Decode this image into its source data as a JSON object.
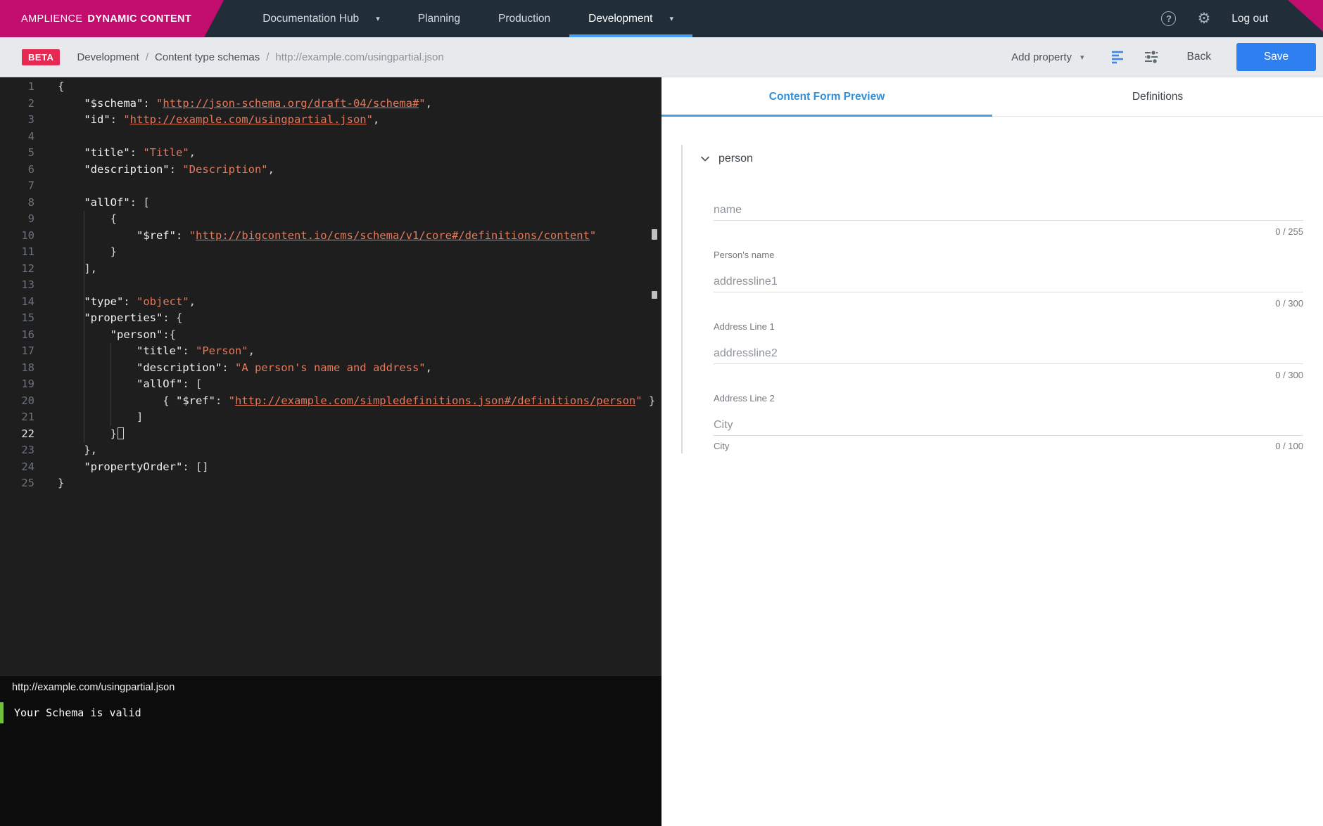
{
  "colors": {
    "brand_pink": "#c10d6e",
    "topnav_bg": "#212e3a",
    "active_tab_blue": "#45a0e6",
    "save_blue": "#2e7ff0",
    "beta_red": "#e42a52",
    "valid_green": "#72c13c",
    "editor_bg": "#1e1e1e",
    "string_orange": "#e5795b"
  },
  "topnav": {
    "brand": {
      "name_light": "AMPLIENCE",
      "name_bold": "DYNAMIC CONTENT"
    },
    "items": [
      {
        "label": "Documentation Hub",
        "has_caret": true,
        "active": false
      },
      {
        "label": "Planning",
        "has_caret": false,
        "active": false
      },
      {
        "label": "Production",
        "has_caret": false,
        "active": false
      },
      {
        "label": "Development",
        "has_caret": true,
        "active": true
      }
    ],
    "help_icon": "?",
    "gear_icon": "gear",
    "logout_label": "Log out"
  },
  "toolbar": {
    "beta_label": "BETA",
    "breadcrumb": [
      "Development",
      "Content type schemas",
      "http://example.com/usingpartial.json"
    ],
    "add_property_label": "Add property",
    "back_label": "Back",
    "save_label": "Save"
  },
  "editor": {
    "filename": "http://example.com/usingpartial.json",
    "validation": "Your Schema is valid",
    "lines": [
      {
        "n": 1,
        "tokens": [
          {
            "t": "{",
            "c": "p"
          }
        ]
      },
      {
        "n": 2,
        "tokens": [
          {
            "t": "    ",
            "c": "p"
          },
          {
            "t": "\"$schema\"",
            "c": "k"
          },
          {
            "t": ": ",
            "c": "p"
          },
          {
            "t": "\"",
            "c": "s"
          },
          {
            "t": "http://json-schema.org/draft-04/schema#",
            "c": "u"
          },
          {
            "t": "\"",
            "c": "s"
          },
          {
            "t": ",",
            "c": "p"
          }
        ]
      },
      {
        "n": 3,
        "tokens": [
          {
            "t": "    ",
            "c": "p"
          },
          {
            "t": "\"id\"",
            "c": "k"
          },
          {
            "t": ": ",
            "c": "p"
          },
          {
            "t": "\"",
            "c": "s"
          },
          {
            "t": "http://example.com/usingpartial.json",
            "c": "u"
          },
          {
            "t": "\"",
            "c": "s"
          },
          {
            "t": ",",
            "c": "p"
          }
        ]
      },
      {
        "n": 4,
        "tokens": []
      },
      {
        "n": 5,
        "tokens": [
          {
            "t": "    ",
            "c": "p"
          },
          {
            "t": "\"title\"",
            "c": "k"
          },
          {
            "t": ": ",
            "c": "p"
          },
          {
            "t": "\"Title\"",
            "c": "s"
          },
          {
            "t": ",",
            "c": "p"
          }
        ]
      },
      {
        "n": 6,
        "tokens": [
          {
            "t": "    ",
            "c": "p"
          },
          {
            "t": "\"description\"",
            "c": "k"
          },
          {
            "t": ": ",
            "c": "p"
          },
          {
            "t": "\"Description\"",
            "c": "s"
          },
          {
            "t": ",",
            "c": "p"
          }
        ]
      },
      {
        "n": 7,
        "tokens": []
      },
      {
        "n": 8,
        "tokens": [
          {
            "t": "    ",
            "c": "p"
          },
          {
            "t": "\"allOf\"",
            "c": "k"
          },
          {
            "t": ": [",
            "c": "p"
          }
        ]
      },
      {
        "n": 9,
        "tokens": [
          {
            "t": "        {",
            "c": "p"
          }
        ]
      },
      {
        "n": 10,
        "tokens": [
          {
            "t": "            ",
            "c": "p"
          },
          {
            "t": "\"$ref\"",
            "c": "k"
          },
          {
            "t": ": ",
            "c": "p"
          },
          {
            "t": "\"",
            "c": "s"
          },
          {
            "t": "http://bigcontent.io/cms/schema/v1/core#/definitions/content",
            "c": "u"
          },
          {
            "t": "\"",
            "c": "s"
          }
        ]
      },
      {
        "n": 11,
        "tokens": [
          {
            "t": "        }",
            "c": "p"
          }
        ]
      },
      {
        "n": 12,
        "tokens": [
          {
            "t": "    ],",
            "c": "p"
          }
        ]
      },
      {
        "n": 13,
        "tokens": []
      },
      {
        "n": 14,
        "tokens": [
          {
            "t": "    ",
            "c": "p"
          },
          {
            "t": "\"type\"",
            "c": "k"
          },
          {
            "t": ": ",
            "c": "p"
          },
          {
            "t": "\"object\"",
            "c": "s"
          },
          {
            "t": ",",
            "c": "p"
          }
        ]
      },
      {
        "n": 15,
        "tokens": [
          {
            "t": "    ",
            "c": "p"
          },
          {
            "t": "\"properties\"",
            "c": "k"
          },
          {
            "t": ": {",
            "c": "p"
          }
        ]
      },
      {
        "n": 16,
        "tokens": [
          {
            "t": "        ",
            "c": "p"
          },
          {
            "t": "\"person\"",
            "c": "k"
          },
          {
            "t": ":{",
            "c": "p"
          }
        ]
      },
      {
        "n": 17,
        "tokens": [
          {
            "t": "            ",
            "c": "p"
          },
          {
            "t": "\"title\"",
            "c": "k"
          },
          {
            "t": ": ",
            "c": "p"
          },
          {
            "t": "\"Person\"",
            "c": "s"
          },
          {
            "t": ",",
            "c": "p"
          }
        ]
      },
      {
        "n": 18,
        "tokens": [
          {
            "t": "            ",
            "c": "p"
          },
          {
            "t": "\"description\"",
            "c": "k"
          },
          {
            "t": ": ",
            "c": "p"
          },
          {
            "t": "\"A person's name and address\"",
            "c": "s"
          },
          {
            "t": ",",
            "c": "p"
          }
        ]
      },
      {
        "n": 19,
        "tokens": [
          {
            "t": "            ",
            "c": "p"
          },
          {
            "t": "\"allOf\"",
            "c": "k"
          },
          {
            "t": ": [",
            "c": "p"
          }
        ]
      },
      {
        "n": 20,
        "tokens": [
          {
            "t": "                { ",
            "c": "p"
          },
          {
            "t": "\"$ref\"",
            "c": "k"
          },
          {
            "t": ": ",
            "c": "p"
          },
          {
            "t": "\"",
            "c": "s"
          },
          {
            "t": "http://example.com/simpledefinitions.json#/definitions/person",
            "c": "u"
          },
          {
            "t": "\"",
            "c": "s"
          },
          {
            "t": " }",
            "c": "p"
          }
        ]
      },
      {
        "n": 21,
        "tokens": [
          {
            "t": "            ]",
            "c": "p"
          }
        ]
      },
      {
        "n": 22,
        "active": true,
        "tokens": [
          {
            "t": "        }",
            "c": "p"
          },
          {
            "t": "",
            "c": "cur"
          }
        ]
      },
      {
        "n": 23,
        "tokens": [
          {
            "t": "    },",
            "c": "p"
          }
        ]
      },
      {
        "n": 24,
        "tokens": [
          {
            "t": "    ",
            "c": "p"
          },
          {
            "t": "\"propertyOrder\"",
            "c": "k"
          },
          {
            "t": ": []",
            "c": "p"
          }
        ]
      },
      {
        "n": 25,
        "tokens": [
          {
            "t": "}",
            "c": "p"
          }
        ]
      }
    ]
  },
  "preview": {
    "tabs": [
      {
        "label": "Content Form Preview",
        "active": true
      },
      {
        "label": "Definitions",
        "active": false
      }
    ],
    "section": {
      "title": "person"
    },
    "fields": [
      {
        "placeholder": "name",
        "counter": "0 / 255",
        "helper": "Person's name",
        "meta_inline": false
      },
      {
        "placeholder": "addressline1",
        "counter": "0 / 300",
        "helper": "Address Line 1",
        "meta_inline": false
      },
      {
        "placeholder": "addressline2",
        "counter": "0 / 300",
        "helper": "Address Line 2",
        "meta_inline": false
      },
      {
        "placeholder": "City",
        "counter": "0 / 100",
        "helper": "City",
        "meta_inline": true
      }
    ]
  }
}
